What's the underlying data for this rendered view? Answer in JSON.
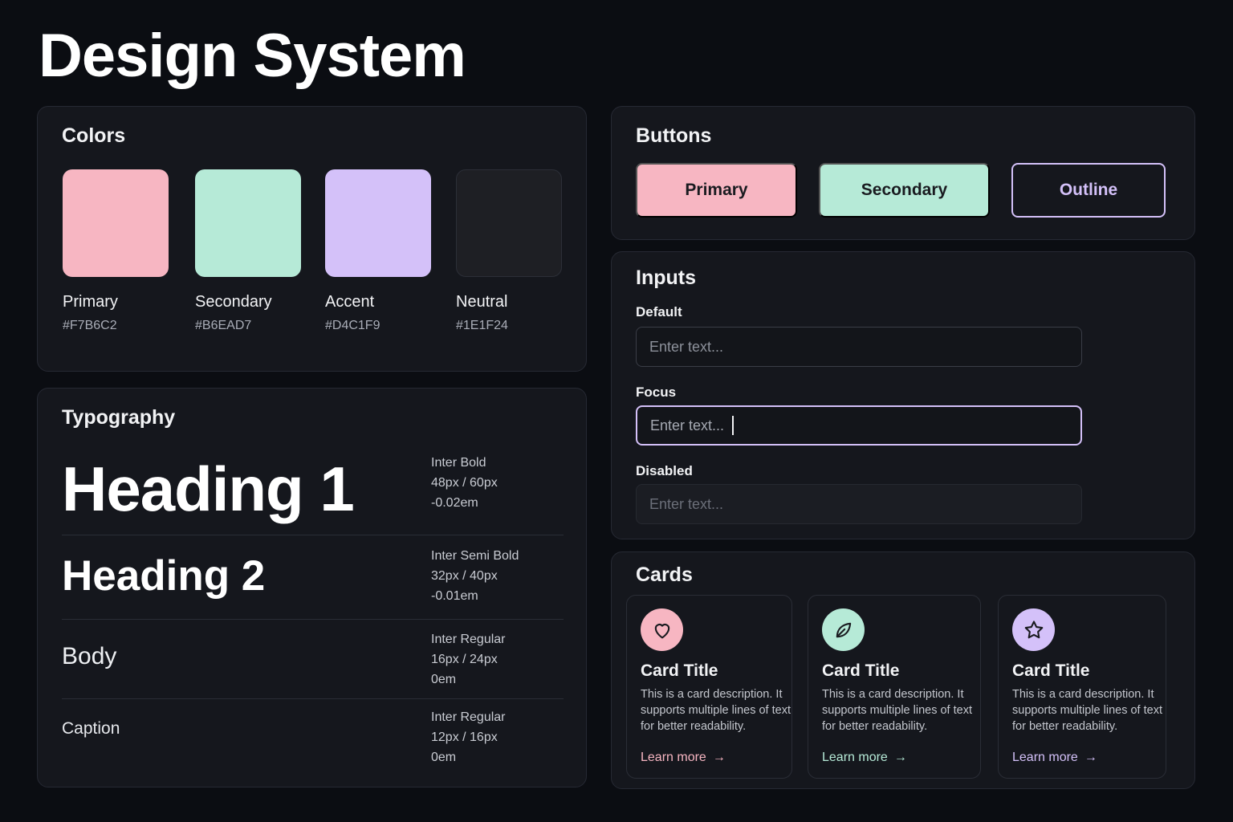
{
  "page": {
    "title": "Design System"
  },
  "colors": {
    "title": "Colors",
    "swatches": [
      {
        "name": "Primary",
        "hex": "#F7B6C2"
      },
      {
        "name": "Secondary",
        "hex": "#B6EAD7"
      },
      {
        "name": "Accent",
        "hex": "#D4C1F9"
      },
      {
        "name": "Neutral",
        "hex": "#1E1F24"
      }
    ]
  },
  "typography": {
    "title": "Typography",
    "rows": [
      {
        "sample": "Heading 1",
        "font": "Inter Bold",
        "size": "48px / 60px",
        "tracking": "-0.02em"
      },
      {
        "sample": "Heading 2",
        "font": "Inter Semi Bold",
        "size": "32px / 40px",
        "tracking": "-0.01em"
      },
      {
        "sample": "Body",
        "font": "Inter Regular",
        "size": "16px / 24px",
        "tracking": "0em"
      },
      {
        "sample": "Caption",
        "font": "Inter Regular",
        "size": "12px / 16px",
        "tracking": "0em"
      }
    ]
  },
  "buttons": {
    "title": "Buttons",
    "primary": "Primary",
    "secondary": "Secondary",
    "outline": "Outline"
  },
  "inputs": {
    "title": "Inputs",
    "fields": [
      {
        "label": "Default",
        "placeholder": "Enter text..."
      },
      {
        "label": "Focus",
        "placeholder": "Enter text..."
      },
      {
        "label": "Disabled",
        "placeholder": "Enter text..."
      }
    ]
  },
  "cards": {
    "title": "Cards",
    "items": [
      {
        "icon": "heart-icon",
        "title": "Card Title",
        "description": "This is a card description. It supports multiple lines of text for better readability.",
        "link": "Learn more",
        "accent": "#F7B6C2"
      },
      {
        "icon": "leaf-icon",
        "title": "Card Title",
        "description": "This is a card description. It supports multiple lines of text for better readability.",
        "link": "Learn more",
        "accent": "#B6EAD7"
      },
      {
        "icon": "star-icon",
        "title": "Card Title",
        "description": "This is a card description. It supports multiple lines of text for better readability.",
        "link": "Learn more",
        "accent": "#D4C1F9"
      }
    ]
  }
}
